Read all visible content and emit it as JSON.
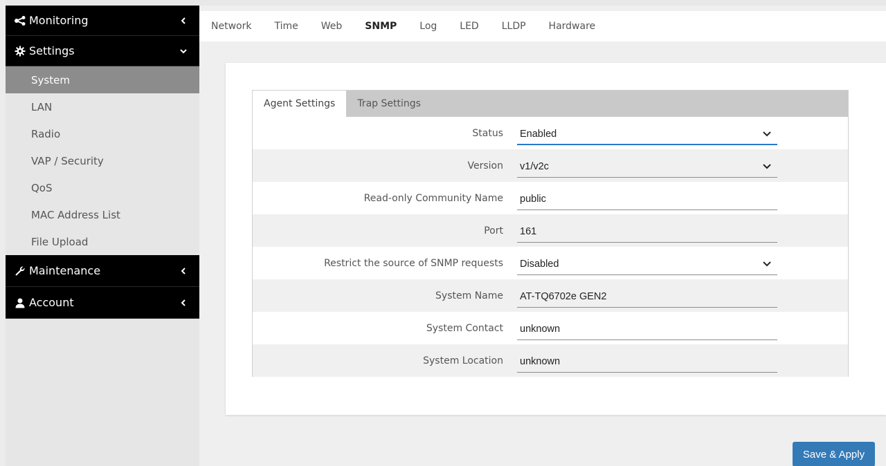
{
  "sidebar": {
    "monitoring": {
      "label": "Monitoring",
      "icon": "share-icon"
    },
    "settings": {
      "label": "Settings",
      "icon": "gear-icon"
    },
    "settings_items": [
      {
        "label": "System",
        "active": true
      },
      {
        "label": "LAN"
      },
      {
        "label": "Radio"
      },
      {
        "label": "VAP / Security"
      },
      {
        "label": "QoS"
      },
      {
        "label": "MAC Address List"
      },
      {
        "label": "File Upload"
      }
    ],
    "maintenance": {
      "label": "Maintenance",
      "icon": "wrench-icon"
    },
    "account": {
      "label": "Account",
      "icon": "user-icon"
    }
  },
  "tabs": [
    "Network",
    "Time",
    "Web",
    "SNMP",
    "Log",
    "LED",
    "LLDP",
    "Hardware"
  ],
  "active_tab": "SNMP",
  "subtabs": [
    "Agent Settings",
    "Trap Settings"
  ],
  "active_subtab": "Agent Settings",
  "form": [
    {
      "label": "Status",
      "value": "Enabled",
      "type": "select"
    },
    {
      "label": "Version",
      "value": "v1/v2c",
      "type": "select"
    },
    {
      "label": "Read-only Community Name",
      "value": "public",
      "type": "text"
    },
    {
      "label": "Port",
      "value": "161",
      "type": "text"
    },
    {
      "label": "Restrict the source of SNMP requests",
      "value": "Disabled",
      "type": "select"
    },
    {
      "label": "System Name",
      "value": "AT-TQ6702e GEN2",
      "type": "text"
    },
    {
      "label": "System Contact",
      "value": "unknown",
      "type": "text"
    },
    {
      "label": "System Location",
      "value": "unknown",
      "type": "text"
    }
  ],
  "save_label": "Save & Apply",
  "colors": {
    "accent": "#337ab7",
    "focus": "#2a78c8",
    "sidebar_header": "#000000"
  }
}
